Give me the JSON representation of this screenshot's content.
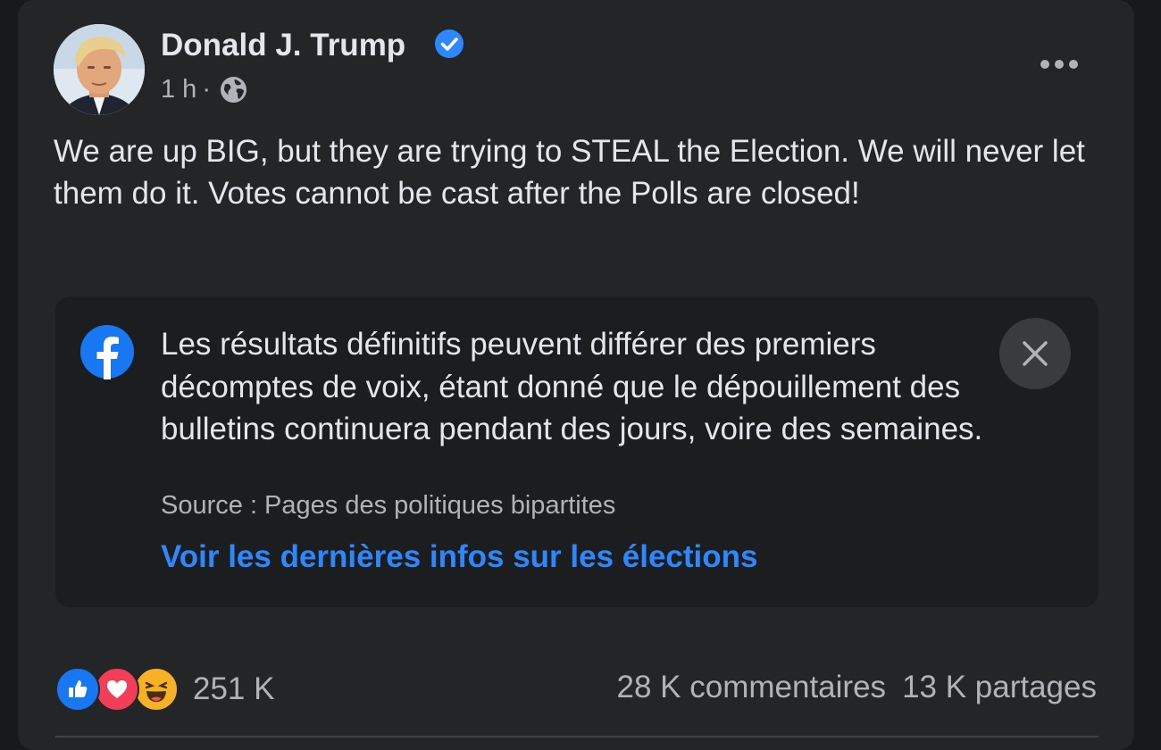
{
  "post": {
    "author": "Donald J. Trump",
    "verified": true,
    "time": "1 h",
    "separator": "·",
    "privacy_icon": "globe-icon",
    "more_icon": "more-options-icon",
    "text": "We are up BIG, but they are trying to STEAL the Election. We will never let them do it. Votes cannot be cast after the Polls are closed!"
  },
  "info_label": {
    "logo_icon": "facebook-logo-icon",
    "message": "Les résultats définitifs peuvent différer des premiers décomptes de voix, étant donné que le dépouillement des bulletins continuera pendant des jours, voire des semaines.",
    "source": "Source : Pages des politiques bipartites",
    "link": "Voir les dernières infos sur les élections",
    "close_icon": "close-icon"
  },
  "engagement": {
    "reactions": [
      "like-icon",
      "love-icon",
      "haha-icon"
    ],
    "reaction_count": "251 K",
    "comments": "28 K commentaires",
    "shares": "13 K partages"
  },
  "colors": {
    "background": "#18191a",
    "card": "#242526",
    "text_primary": "#e4e6eb",
    "text_secondary": "#b0b3b8",
    "link": "#2d88ff",
    "verified": "#2d88ff"
  }
}
